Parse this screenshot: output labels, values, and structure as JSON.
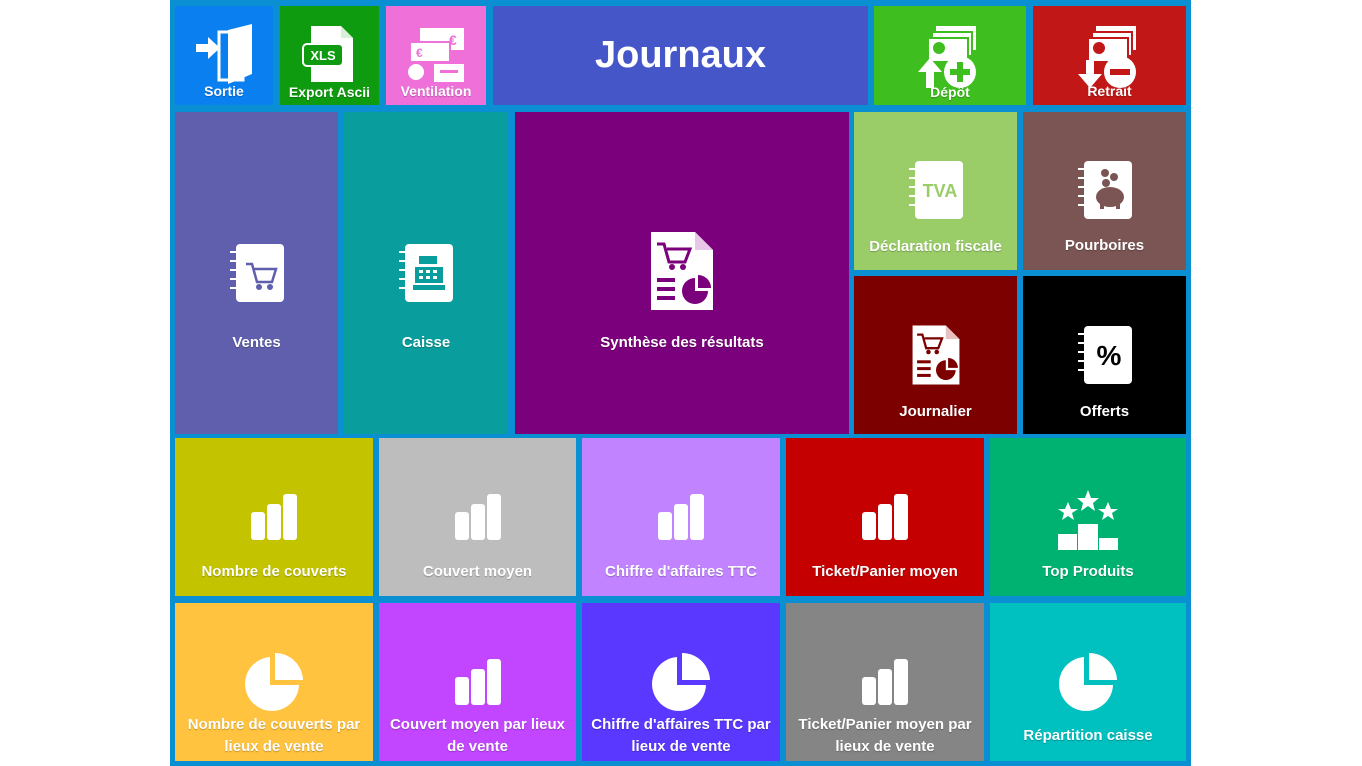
{
  "title": "Journaux",
  "top": {
    "exit": "Sortie",
    "export": "Export Ascii",
    "export_icon_text": "XLS",
    "ventilation": "Ventilation",
    "deposit": "Dépôt",
    "withdraw": "Retrait"
  },
  "journals": {
    "sales": "Ventes",
    "cash": "Caisse",
    "summary": "Synthèse des résultats",
    "tax": "Déclaration fiscale",
    "tax_icon_text": "TVA",
    "tips": "Pourboires",
    "daily": "Journalier",
    "offered": "Offerts",
    "offered_icon_text": "%"
  },
  "stats": {
    "covers": "Nombre de couverts",
    "avg_cover": "Couvert moyen",
    "revenue": "Chiffre d'affaires TTC",
    "avg_ticket": "Ticket/Panier moyen",
    "top_products": "Top Produits",
    "covers_by_place": "Nombre de couverts par lieux de vente",
    "avg_cover_by_place": "Couvert moyen par lieux de vente",
    "revenue_by_place": "Chiffre d'affaires TTC par lieux de vente",
    "avg_ticket_by_place": "Ticket/Panier moyen par lieux de vente",
    "cash_split": "Répartition caisse"
  },
  "icons": {
    "exit": "door-exit-icon",
    "export": "xls-file-icon",
    "ventilation": "money-split-icon",
    "deposit": "money-deposit-icon",
    "withdraw": "money-withdraw-icon",
    "sales": "notebook-cart-icon",
    "cash": "notebook-register-icon",
    "summary": "report-cart-pie-icon",
    "tax": "notebook-tva-icon",
    "tips": "notebook-piggy-icon",
    "daily": "report-cart-pie-icon",
    "offered": "notebook-percent-icon",
    "bar": "bar-chart-icon",
    "pie": "pie-chart-icon",
    "podium": "podium-stars-icon"
  },
  "colors": {
    "background": "#0b8fd3",
    "exit": "#0a7ff0",
    "export": "#0f9b0f",
    "ventilation": "#ee70d8",
    "title": "#4557c8",
    "deposit": "#3fbe1f",
    "withdraw": "#c21717",
    "sales": "#5f5fae",
    "cash": "#0a9d9d",
    "summary": "#7b007b",
    "tax": "#9acd68",
    "tips": "#7b5454",
    "daily": "#7d0000",
    "offered": "#000000",
    "covers": "#c3c300",
    "avg_cover": "#bdbdbd",
    "revenue": "#c183ff",
    "avg_ticket": "#c40000",
    "top_products": "#00b272",
    "covers_by_place": "#ffc340",
    "avg_cover_by_place": "#c246ff",
    "revenue_by_place": "#5a38ff",
    "avg_ticket_by_place": "#858585",
    "cash_split": "#00c0c0"
  }
}
